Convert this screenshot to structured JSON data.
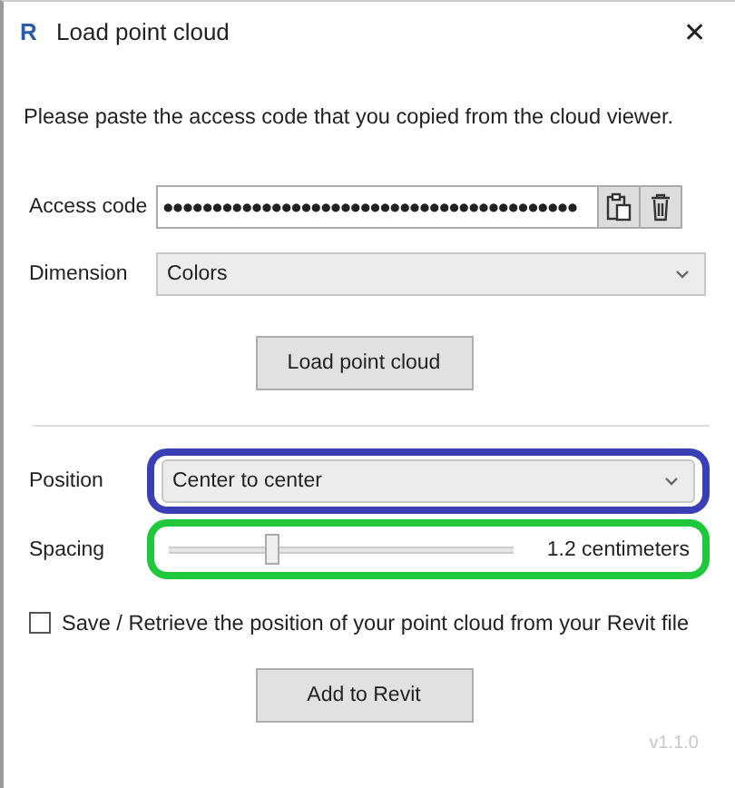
{
  "window": {
    "icon_letter": "R",
    "title": "Load point cloud",
    "close": "✕"
  },
  "instruction": "Please paste the access code that you copied from the cloud viewer.",
  "access_code": {
    "label": "Access code",
    "value": "●●●●●●●●●●●●●●●●●●●●●●●●●●●●●●●●●●●●●●●●●●"
  },
  "dimension": {
    "label": "Dimension",
    "value": "Colors"
  },
  "load_button": "Load point cloud",
  "settings": [
    {
      "kind": "dropdown",
      "label": "Position",
      "value": "Center to center",
      "color": "#3a3fb5"
    },
    {
      "kind": "slider",
      "label": "Spacing",
      "level": 0.3,
      "reading": "1.2 centimeters",
      "color": "#1ec83a"
    }
  ],
  "save_option": {
    "label": "Save / Retrieve the position of your point cloud from your Revit file",
    "checked": false
  },
  "add_button": "Add to Revit",
  "version": "v1.1.0"
}
